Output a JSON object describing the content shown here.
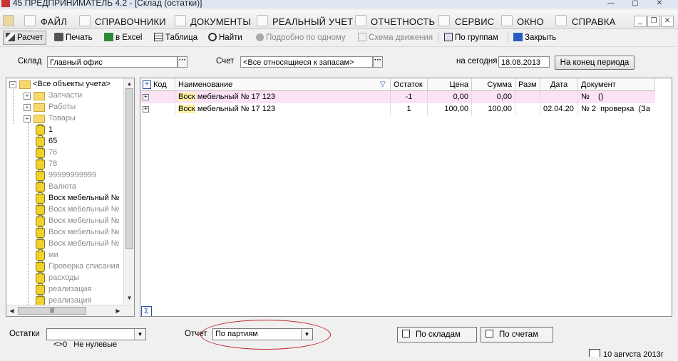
{
  "window": {
    "title": "45 ПРЕДПРИНИМАТЕЛЬ 4.2 - [Склад (остатки)]"
  },
  "menu": {
    "items": [
      "ФАЙЛ",
      "СПРАВОЧНИКИ",
      "ДОКУМЕНТЫ",
      "РЕАЛЬНЫЙ УЧЕТ",
      "ОТЧЕТНОСТЬ",
      "СЕРВИС",
      "ОКНО",
      "СПРАВКА"
    ]
  },
  "toolbar": {
    "calc": "Расчет",
    "print": "Печать",
    "excel": "в Excel",
    "table": "Таблица",
    "find": "Найти",
    "detail": "Подробно по одному",
    "scheme": "Схема движения",
    "groups": "По группам",
    "close": "Закрыть"
  },
  "filters": {
    "warehouse_label": "Склад",
    "warehouse_value": "Главный офис",
    "account_label": "Счет",
    "account_value": "<Все относящиеся к запасам>",
    "today_label": "на сегодня",
    "date_value": "18.08.2013",
    "period_end_button": "На конец периода"
  },
  "tree": {
    "root": "<Все объекты учета>",
    "folders": [
      "Запчасти",
      "Работы",
      "Товары"
    ],
    "items": [
      {
        "label": "1",
        "active": true
      },
      {
        "label": "65",
        "active": true
      },
      {
        "label": "76",
        "active": false
      },
      {
        "label": "78",
        "active": false
      },
      {
        "label": "99999999999",
        "active": false
      },
      {
        "label": "Валюта",
        "active": false
      },
      {
        "label": "Воск мебельный №",
        "active": true
      },
      {
        "label": "Воск мебельный №",
        "active": false
      },
      {
        "label": "Воск мебельный №",
        "active": false
      },
      {
        "label": "Воск мебельный №",
        "active": false
      },
      {
        "label": "Воск мебельный №",
        "active": false
      },
      {
        "label": "ми",
        "active": false
      },
      {
        "label": "Проверка списания",
        "active": false
      },
      {
        "label": "расходы",
        "active": false
      },
      {
        "label": "реализация",
        "active": false
      },
      {
        "label": "реализация",
        "active": false
      }
    ]
  },
  "grid": {
    "columns": [
      "Код",
      "Наименование",
      "Остаток",
      "Цена",
      "Сумма",
      "Разм",
      "Дата",
      "Документ"
    ],
    "rows": [
      {
        "code": "",
        "name_hl": "Воск",
        "name_rest": " мебельный № 17 123",
        "qty": "-1",
        "price": "0,00",
        "sum": "0,00",
        "size": "",
        "date": "",
        "doc": "№    ()"
      },
      {
        "code": "",
        "name_hl": "Воск",
        "name_rest": " мебельный № 17 123",
        "qty": "1",
        "price": "100,00",
        "sum": "100,00",
        "size": "",
        "date": "02.04.20",
        "doc": "№ 2  проверка  (За"
      }
    ],
    "sum_symbol": "Σ"
  },
  "bottom": {
    "rest_label": "Остатки",
    "rest_value": "<>0   Не нулевые",
    "report_label": "Отчет",
    "report_value": "По партиям",
    "by_warehouses": "По складам",
    "by_accounts": "По счетам"
  },
  "status": {
    "date": "10 августа 2013г"
  },
  "colors": {
    "highlight_row": "#fbe3f5",
    "annotation_ellipse": "#c0202a"
  }
}
